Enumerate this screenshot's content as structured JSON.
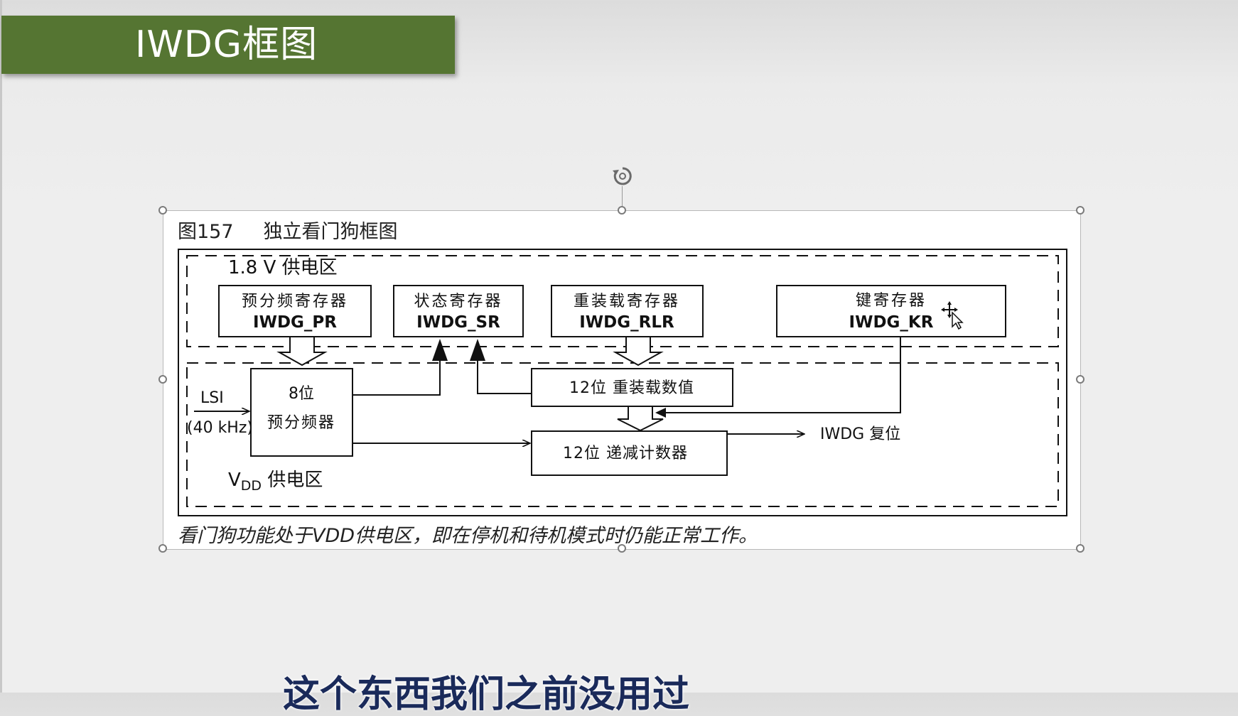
{
  "slide": {
    "title": "IWDG框图"
  },
  "figure": {
    "label": "图157",
    "title": "独立看门狗框图",
    "caption": "看门狗功能处于VDD供电区，即在停机和待机模式时仍能正常工作。"
  },
  "diagram": {
    "zone_18v": "1.8 V 供电区",
    "zone_vdd_v": "V",
    "zone_vdd_sub": "DD",
    "zone_vdd_rest": " 供电区",
    "prescaler_reg": {
      "cn": "预分频寄存器",
      "name": "IWDG_PR"
    },
    "status_reg": {
      "cn": "状态寄存器",
      "name": "IWDG_SR"
    },
    "reload_reg": {
      "cn": "重装载寄存器",
      "name": "IWDG_RLR"
    },
    "key_reg": {
      "cn": "键寄存器",
      "name": "IWDG_KR"
    },
    "prescaler": {
      "line1": "8位",
      "line2": "预分频器"
    },
    "reload_value": "12位 重装载数值",
    "down_counter": "12位 递减计数器",
    "lsi_label": "LSI",
    "lsi_freq": "(40 kHz)",
    "reset_label": "IWDG 复位"
  },
  "subtitle": {
    "text": "这个东西我们之前没用过"
  },
  "colors": {
    "title_bar": "#557532",
    "title_text": "#ffffff",
    "diagram_stroke": "#111111"
  }
}
